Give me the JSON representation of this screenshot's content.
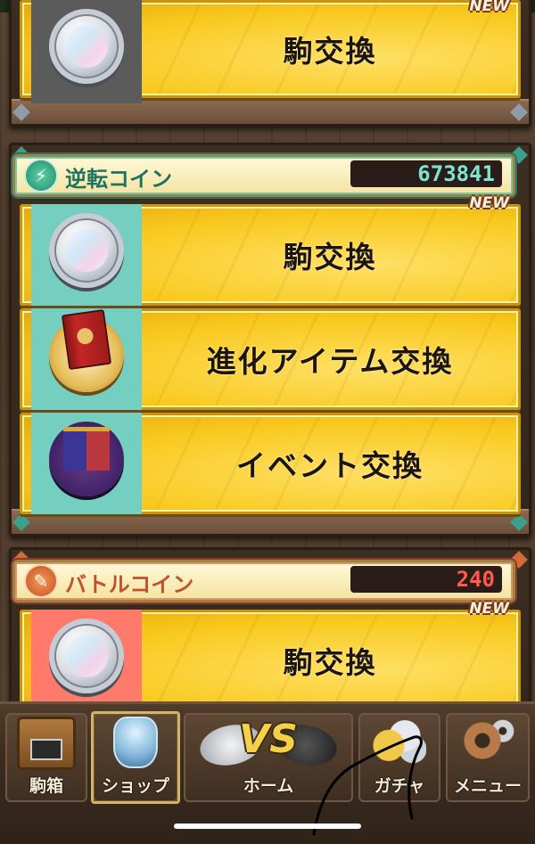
{
  "sections": {
    "top": {
      "rows": [
        {
          "label": "駒交換",
          "badge": "NEW",
          "thumb": "silver-coin"
        }
      ]
    },
    "gyakuten": {
      "coin_name": "逆転コイン",
      "coin_value": "673841",
      "icon": "lightning-icon",
      "accent": "#1e7460",
      "rows": [
        {
          "label": "駒交換",
          "badge": "NEW",
          "thumb": "silver-coin"
        },
        {
          "label": "進化アイテム交換",
          "badge": "",
          "thumb": "red-book"
        },
        {
          "label": "イベント交換",
          "badge": "",
          "thumb": "banner-emblem"
        }
      ]
    },
    "battle": {
      "coin_name": "バトルコイン",
      "coin_value": "240",
      "icon": "sword-icon",
      "accent": "#c3512a",
      "rows": [
        {
          "label": "駒交換",
          "badge": "NEW",
          "thumb": "silver-coin"
        }
      ]
    }
  },
  "nav": {
    "items": [
      {
        "label": "駒箱",
        "icon": "treasure-chest-icon"
      },
      {
        "label": "ショップ",
        "icon": "shop-potion-icon",
        "selected": true
      },
      {
        "label": "ホーム",
        "icon": "vs-icon",
        "logo": "VS"
      },
      {
        "label": "ガチャ",
        "icon": "gacha-coins-icon"
      },
      {
        "label": "メニュー",
        "icon": "gear-icon"
      }
    ]
  },
  "colors": {
    "row_gold": "#f8c91e",
    "thumb_gray": "#5b5b5b",
    "thumb_teal": "#74cfc0",
    "thumb_coral": "#ff7a6b"
  }
}
